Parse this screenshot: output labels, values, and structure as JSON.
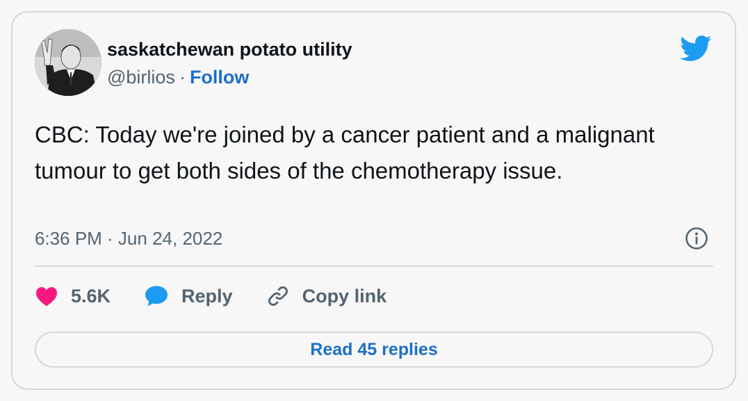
{
  "author": {
    "display_name": "saskatchewan potato utility",
    "handle": "@birlios",
    "separator": "·",
    "follow_label": "Follow"
  },
  "tweet": {
    "text": "CBC: Today we're joined by a cancer patient and a malignant tumour to get both sides of the chemotherapy issue.",
    "timestamp": "6:36 PM · Jun 24, 2022"
  },
  "actions": {
    "like_count": "5.6K",
    "reply_label": "Reply",
    "copy_link_label": "Copy link"
  },
  "read_replies_label": "Read 45 replies",
  "icons": {
    "brand": "twitter-bird-icon",
    "info": "info-icon",
    "like": "heart-icon",
    "reply": "speech-bubble-icon",
    "copy": "link-icon"
  },
  "colors": {
    "accent": "#1d6fc9",
    "twitter_blue": "#1d9bf0",
    "like_pink": "#f91880",
    "muted": "#536471",
    "border": "#cfd9de"
  }
}
